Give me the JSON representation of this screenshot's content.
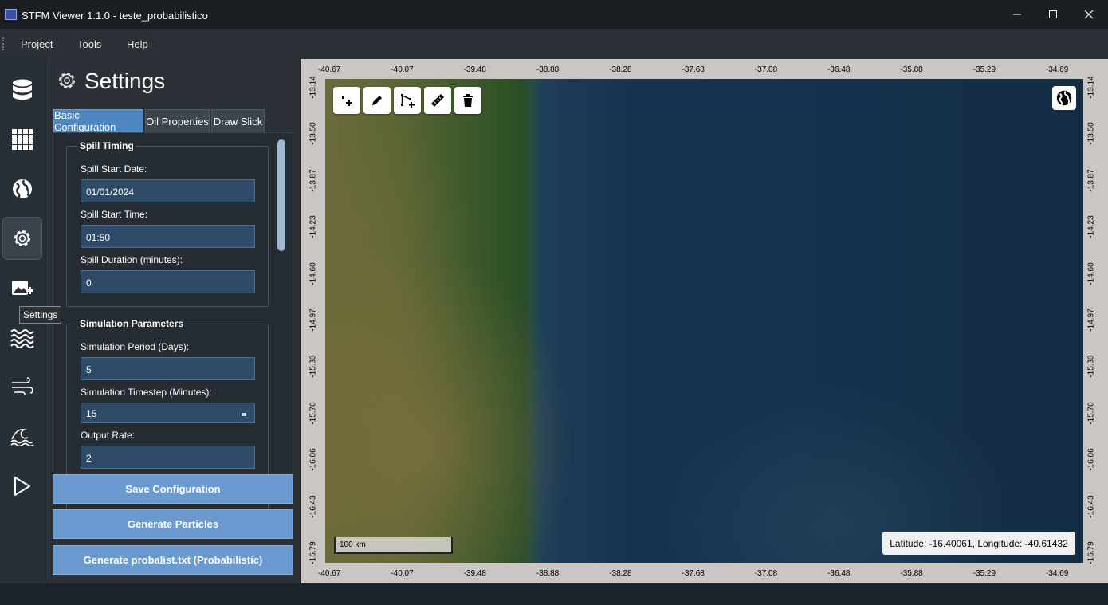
{
  "window": {
    "title": "STFM Viewer 1.1.0 - teste_probabilistico",
    "minimize_icon": "minimize-icon",
    "maximize_icon": "maximize-icon",
    "close_icon": "close-icon"
  },
  "menu": {
    "items": [
      "Project",
      "Tools",
      "Help"
    ]
  },
  "rail": {
    "items": [
      {
        "icon": "database-icon"
      },
      {
        "icon": "grid-icon"
      },
      {
        "icon": "globe-icon"
      },
      {
        "icon": "gear-icon",
        "active": true
      },
      {
        "icon": "add-image-icon"
      },
      {
        "icon": "waves-icon"
      },
      {
        "icon": "wind-icon"
      },
      {
        "icon": "ocean-wave-icon"
      },
      {
        "icon": "play-icon"
      }
    ],
    "tooltip": "Settings"
  },
  "panel": {
    "title": "Settings",
    "tabs": [
      "Basic Configuration",
      "Oil Properties",
      "Draw Slick"
    ],
    "active_tab": "Basic Configuration",
    "spill_timing": {
      "title": "Spill Timing",
      "start_date_label": "Spill Start Date:",
      "start_date_value": "01/01/2024",
      "start_time_label": "Spill Start Time:",
      "start_time_value": "01:50",
      "duration_label": "Spill Duration (minutes):",
      "duration_value": "0"
    },
    "simulation_parameters": {
      "title": "Simulation Parameters",
      "period_label": "Simulation Period (Days):",
      "period_value": "5",
      "timestep_label": "Simulation Timestep (Minutes):",
      "timestep_value": "15",
      "output_rate_label": "Output Rate:",
      "output_rate_value": "2"
    },
    "buttons": {
      "save": "Save Configuration",
      "generate_particles": "Generate Particles",
      "generate_probalist": "Generate probalist.txt (Probabilistic)"
    }
  },
  "map": {
    "top_ticks": [
      "-40.67",
      "-40.07",
      "-39.48",
      "-38.88",
      "-38.28",
      "-37.68",
      "-37.08",
      "-36.48",
      "-35.88",
      "-35.29",
      "-34.69"
    ],
    "bottom_ticks": [
      "-40.67",
      "-40.07",
      "-39.48",
      "-38.88",
      "-38.28",
      "-37.68",
      "-37.08",
      "-36.48",
      "-35.88",
      "-35.29",
      "-34.69"
    ],
    "left_ticks": [
      "-13.14",
      "-13.50",
      "-13.87",
      "-14.23",
      "-14.60",
      "-14.97",
      "-15.33",
      "-15.70",
      "-16.06",
      "-16.43",
      "-16.79"
    ],
    "right_ticks": [
      "-13.14",
      "-13.50",
      "-13.87",
      "-14.23",
      "-14.60",
      "-14.97",
      "-15.33",
      "-15.70",
      "-16.06",
      "-16.43",
      "-16.79"
    ],
    "tools": [
      "add-point-icon",
      "pencil-icon",
      "polyline-icon",
      "ruler-icon",
      "trash-icon"
    ],
    "globe_icon": "globe-icon",
    "scale_label": "100 km",
    "coordinates": "Latitude: -16.40061, Longitude: -40.61432"
  },
  "colors": {
    "accent": "#4f86bd",
    "button": "#6b9ad0",
    "panel_bg": "#2b3136",
    "field_bg": "#2f4a67"
  }
}
